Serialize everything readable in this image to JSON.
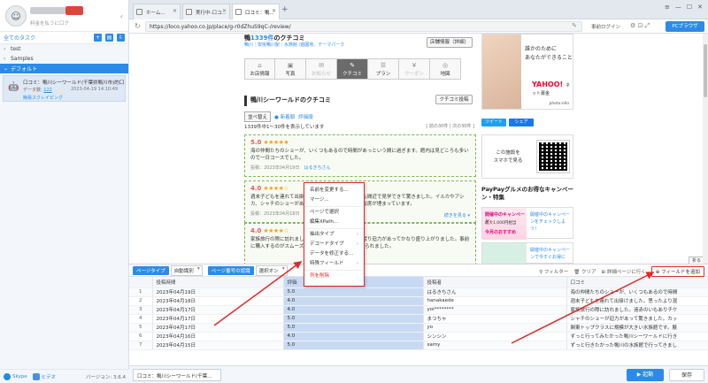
{
  "sidebar": {
    "subtitle": "料金を払うに口ク",
    "all_tasks": "全てのタスク",
    "tree": [
      {
        "arrow": "›",
        "label": "test"
      },
      {
        "arrow": "›",
        "label": "Samples"
      },
      {
        "arrow": "⌄",
        "label": "デフォルト"
      }
    ],
    "task": {
      "title": "口コミ：鴨川シーワールド(千葉県鴨川市)的口",
      "count_label": "データ数:",
      "count": "122",
      "date": "2023-04-19 14:10:49",
      "mode": "簡易スクレイピング"
    },
    "footer": {
      "skype": "Skype",
      "help": "ヒデオ",
      "version": "バージョン: 3.6.4"
    }
  },
  "browser": {
    "tabs": [
      {
        "label": "ホーム..."
      },
      {
        "label": "実行中-口コ..."
      },
      {
        "label": "口コミ：鴨..."
      }
    ],
    "url": "https://loco.yahoo.co.jp/place/g-r0dZhuS9qC-/review/",
    "login": "事前ログイン",
    "pc_browser": "PCブラウザ"
  },
  "webpage": {
    "title_prefix": "鴨",
    "title_count": "1339件",
    "title_suffix": "のクチコミ",
    "breadcrumb_prefix": "鴨川｜",
    "breadcrumb_rest": "安房鴨川駅｜水族館 /遊園地、テーマパーク",
    "detail_btn": "店舗情報（詳細）",
    "nav_tabs": [
      {
        "icon": "⌂",
        "label": "お店情報",
        "state": ""
      },
      {
        "icon": "▣",
        "label": "写真",
        "state": ""
      },
      {
        "icon": "✉",
        "label": "お知らせ",
        "state": "dis"
      },
      {
        "icon": "✎",
        "label": "クチコミ",
        "state": "active"
      },
      {
        "icon": "☰",
        "label": "プラン",
        "state": ""
      },
      {
        "icon": "¥",
        "label": "クーポン",
        "state": "dis"
      },
      {
        "icon": "◎",
        "label": "地図",
        "state": ""
      }
    ],
    "section_title": "鴨川シーワールドのクチコミ",
    "post_btn": "クチコミ投稿",
    "sort_btn": "並べ替え",
    "sort_new": "新着順",
    "sort_rating": "評価順",
    "range": "1339件中1～30件を表示しています",
    "page_info": "[ 前の30件 | 次の30件 ]",
    "reviews": [
      {
        "score": "5.0",
        "stars": "★★★★★",
        "text": "海の仲間たちのショーが、いくつもあるので時間があっという間に過ぎます。館内は見どころも多いので一日コースでした。",
        "meta": "投稿：2023年04月19日　",
        "user": "はるきちさん",
        "more": ""
      },
      {
        "score": "4.0",
        "stars": "★★★★☆",
        "text": "週末子どもを連れて出掛けました。大型の海洋生物も間近で見学できて驚きました。イルカやアシカ、シャチのショーがありますが、開始の少し前には席が埋まっています。",
        "meta": "投稿：2023年04月18日　",
        "user": "hanakaede",
        "more": "続きを見る ▾"
      },
      {
        "score": "4.0",
        "stars": "★★★★☆",
        "text": "家族旅行の際に訪れました。イルカのショーはやっぱり迫力があってかなり盛り上がりました。事前に購入するのがスムーズです。ショー毎4つくらい見られました。",
        "meta": "",
        "user": "",
        "more": ""
      },
      {
        "score": "5.0",
        "stars": "★★★★★",
        "text": "",
        "meta": "",
        "user": "",
        "more": ""
      }
    ],
    "ad": {
      "copy1": "誰かのために",
      "copy2": "あなたができること",
      "brand": "YAHOO!",
      "brand_sub": "ネット募金",
      "photo": "photo:ello"
    },
    "share": {
      "tweet": "ツイート",
      "fb": "シェア"
    },
    "qr": {
      "line1": "この施設を",
      "line2": "スマホで見る"
    },
    "paypay": {
      "title": "PayPayグルメのお得なキャンペーン・特集"
    },
    "banner1": {
      "head": "開催中のキャンペーン",
      "mid": "最大1,000円相当",
      "low": "今月のおすすめ",
      "text": "開催中のキャンペーンをチェックしよう！"
    },
    "banner2": {
      "text": "開催中のキャンペーンで今すぐお得に"
    },
    "fold": "折る"
  },
  "context_menu": [
    {
      "label": "名前を変更する...",
      "sub": ""
    },
    {
      "label": "マージ...",
      "sub": ""
    },
    {
      "label": "ページで選択",
      "sub": ""
    },
    {
      "label": "編集XPath...",
      "sub": ""
    },
    {
      "label": "抽出タイプ",
      "sub": "›"
    },
    {
      "label": "デコードタイプ",
      "sub": "›"
    },
    {
      "label": "データを修正する...",
      "sub": ""
    },
    {
      "label": "特殊フィールド",
      "sub": "›"
    },
    {
      "label": "列を削除",
      "sub": "",
      "red": true
    }
  ],
  "data_panel": {
    "page_type_btn": "ページタイプ",
    "page_type_val": "自動識別",
    "page_num_btn": "ページ番号の認識",
    "page_num_val": "選択オン",
    "filter": "フィルター",
    "clear": "クリア",
    "detail_page": "詳細ページに行く",
    "add_field": "フィールドを追加",
    "columns": [
      "投稿時間",
      "評価",
      "投稿者",
      "口コミ"
    ],
    "rows": [
      [
        "1",
        "2023年04月19日",
        "5.0",
        "はるきちさん",
        "海の仲間たちのショーが、いくつもあるので時間"
      ],
      [
        "2",
        "2023年04月18日",
        "4.0",
        "hanakaede",
        "週末子どもを連れて出掛けました。思ったより混"
      ],
      [
        "3",
        "2023年04月17日",
        "4.0",
        "yoi********",
        "家族旅行の際に訪れました。遠赤のいもありチケ"
      ],
      [
        "4",
        "2023年04月17日",
        "5.0",
        "まつちゃ",
        "シャチのショーが迫力があって驚きました。カッ"
      ],
      [
        "5",
        "2023年04月17日",
        "5.0",
        "yo",
        "関東トップクラスに規模が大きい水族館です。展"
      ],
      [
        "6",
        "2023年04月16日",
        "4.0",
        "シンシン",
        "ずっと行ってみたかった鴨川シーワールドに行き"
      ],
      [
        "7",
        "2023年04月15日",
        "5.0",
        "samy",
        "ずっと行きたかった鴨川の水族館で行ってきまし"
      ]
    ]
  },
  "bottom": {
    "tab_label": "口コミ：鴨川シーワールド(千葉...",
    "collect": "▶ 起動",
    "save": "保存"
  }
}
